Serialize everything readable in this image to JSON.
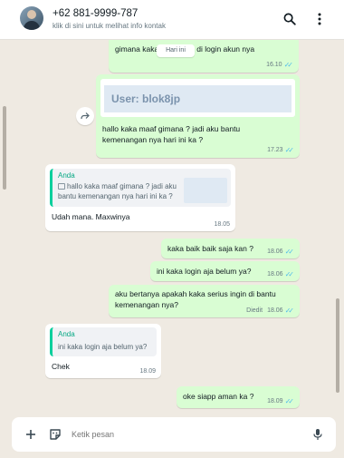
{
  "header": {
    "contact_name": "+62 881-9999-787",
    "subtitle": "klik di sini untuk melihat info kontak"
  },
  "date_separator": "Hari ini",
  "messages": [
    {
      "text": "gimana kaka ??kenapa di login akun nya",
      "time": "16.10"
    },
    {
      "image_text": "User: blok8jp",
      "text": "hallo kaka maaf gimana ? jadi aku bantu kemenangan nya hari ini ka ?",
      "time": "17.23"
    },
    {
      "quote_author": "Anda",
      "quote_text": "hallo kaka maaf gimana ? jadi aku bantu kemenangan nya hari ini ka ?",
      "text": "Udah mana. Maxwinya",
      "time": "18.05"
    },
    {
      "text": "kaka baik baik saja kan ?",
      "time": "18.06"
    },
    {
      "text": "ini kaka login aja belum ya?",
      "time": "18.06"
    },
    {
      "text": "aku bertanya apakah kaka serius ingin di bantu kemenangan nya?",
      "time": "18.06",
      "status": "Diedit"
    },
    {
      "quote_author": "Anda",
      "quote_text": "ini kaka login aja belum ya?",
      "text": "Chek",
      "time": "18.09"
    },
    {
      "text": "oke siapp aman ka ?",
      "time": "18.09"
    }
  ],
  "composer": {
    "placeholder": "Ketik pesan"
  },
  "icons": [
    "search-icon",
    "menu-icon",
    "forward-icon",
    "photo-icon",
    "plus-icon",
    "sticker-icon",
    "mic-icon"
  ],
  "colors": {
    "outgoing": "#d9fdd3",
    "incoming": "#ffffff",
    "background": "#efeae2",
    "read_ticks": "#53bdeb",
    "quote_accent": "#06cf9c"
  }
}
